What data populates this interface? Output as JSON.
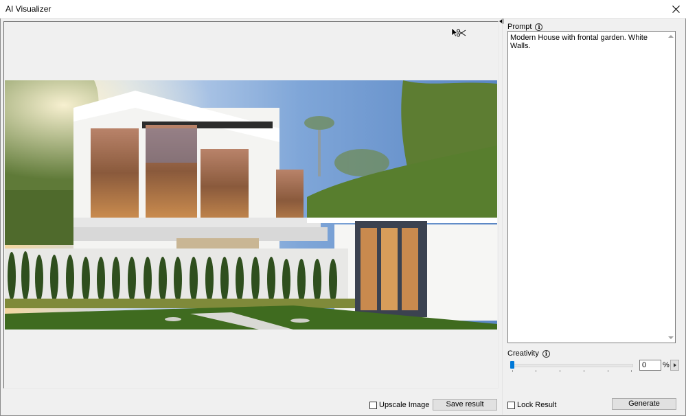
{
  "window": {
    "title": "AI Visualizer"
  },
  "prompt": {
    "label": "Prompt",
    "text": "Modern House with frontal garden. White Walls."
  },
  "creativity": {
    "label": "Creativity",
    "value": "0",
    "unit": "%",
    "slider_fraction": 0
  },
  "actions": {
    "upscale_label": "Upscale Image",
    "save_label": "Save result",
    "lock_label": "Lock Result",
    "generate_label": "Generate"
  },
  "colors": {
    "accent": "#0078d7",
    "button_bg": "#e1e1e1",
    "panel_bg": "#f0f0f0"
  },
  "icons": [
    "close-icon",
    "cursor-icon",
    "scissors-icon",
    "info-icon",
    "collapse-arrow-icon",
    "spin-right-icon"
  ]
}
